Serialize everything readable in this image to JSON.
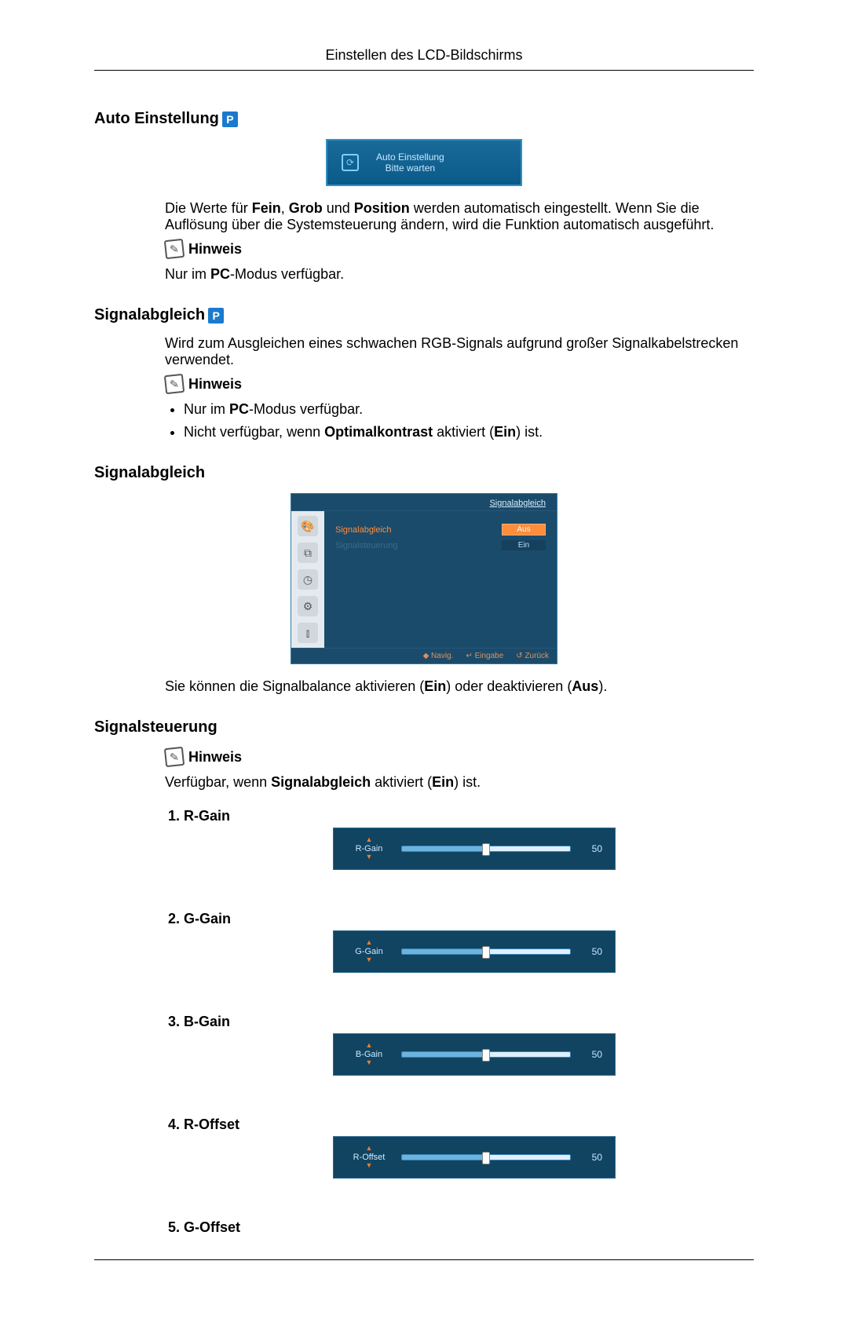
{
  "header_title": "Einstellen des LCD-Bildschirms",
  "p_badge": "P",
  "sections": {
    "auto": {
      "heading": "Auto Einstellung",
      "box_line1": "Auto Einstellung",
      "box_line2": "Bitte warten",
      "para_pre": "Die Werte für ",
      "para_b1": "Fein",
      "para_mid1": ", ",
      "para_b2": "Grob",
      "para_mid2": " und ",
      "para_b3": "Position",
      "para_post": " werden automatisch eingestellt. Wenn Sie die Auflösung über die Systemsteuerung ändern, wird die Funktion automatisch ausgeführt.",
      "hinweis": "Hinweis",
      "pc_pre": "Nur im ",
      "pc_b": "PC",
      "pc_post": "-Modus verfügbar."
    },
    "signalabgleich1": {
      "heading": "Signalabgleich",
      "para": "Wird zum Ausgleichen eines schwachen RGB-Signals aufgrund großer Signalkabelstrecken verwendet.",
      "hinweis": "Hinweis",
      "b1_pre": "Nur im ",
      "b1_b": "PC",
      "b1_post": "-Modus verfügbar.",
      "b2_pre": "Nicht verfügbar, wenn ",
      "b2_b": "Optimalkontrast",
      "b2_mid": " aktiviert (",
      "b2_b2": "Ein",
      "b2_post": ") ist."
    },
    "signalabgleich2": {
      "heading": "Signalabgleich",
      "osd_title": "Signalabgleich",
      "osd_row1_label": "Signalabgleich",
      "osd_row1_opt1": "Aus",
      "osd_row1_opt2": "Ein",
      "osd_row2_label": "Signalsteuerung",
      "osd_footer_navig": "Navig.",
      "osd_footer_eingabe": "Eingabe",
      "osd_footer_zurueck": "Zurück",
      "para_pre": "Sie können die Signalbalance aktivieren (",
      "para_b1": "Ein",
      "para_mid": ") oder deaktivieren (",
      "para_b2": "Aus",
      "para_post": ")."
    },
    "signalsteuerung": {
      "heading": "Signalsteuerung",
      "hinweis": "Hinweis",
      "para_pre": "Verfügbar, wenn ",
      "para_b1": "Signalabgleich",
      "para_mid": " aktiviert (",
      "para_b2": "Ein",
      "para_post": ") ist.",
      "items": [
        {
          "label": "R-Gain",
          "slider_label": "R-Gain",
          "value": "50"
        },
        {
          "label": "G-Gain",
          "slider_label": "G-Gain",
          "value": "50"
        },
        {
          "label": "B-Gain",
          "slider_label": "B-Gain",
          "value": "50"
        },
        {
          "label": "R-Offset",
          "slider_label": "R-Offset",
          "value": "50"
        },
        {
          "label": "G-Offset",
          "slider_label": "",
          "value": ""
        }
      ]
    }
  }
}
